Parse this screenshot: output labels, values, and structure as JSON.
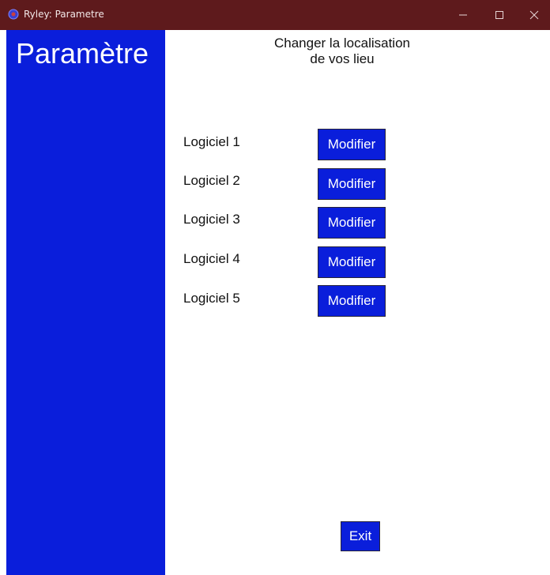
{
  "window": {
    "title": "Ryley: Parametre",
    "titlebar_color": "#5e1a1c",
    "icons": [
      "app-icon",
      "minimize-icon",
      "maximize-icon",
      "close-icon"
    ]
  },
  "sidebar": {
    "title": "Paramètre",
    "color": "#0a1edb"
  },
  "main": {
    "heading_line1": "Changer la localisation",
    "heading_line2": "de vos lieu",
    "rows": [
      {
        "label": "Logiciel 1",
        "button": "Modifier"
      },
      {
        "label": "Logiciel 2",
        "button": "Modifier"
      },
      {
        "label": "Logiciel 3",
        "button": "Modifier"
      },
      {
        "label": "Logiciel 4",
        "button": "Modifier"
      },
      {
        "label": "Logiciel 5",
        "button": "Modifier"
      }
    ],
    "exit_label": "Exit",
    "button_color": "#0a1edb"
  }
}
